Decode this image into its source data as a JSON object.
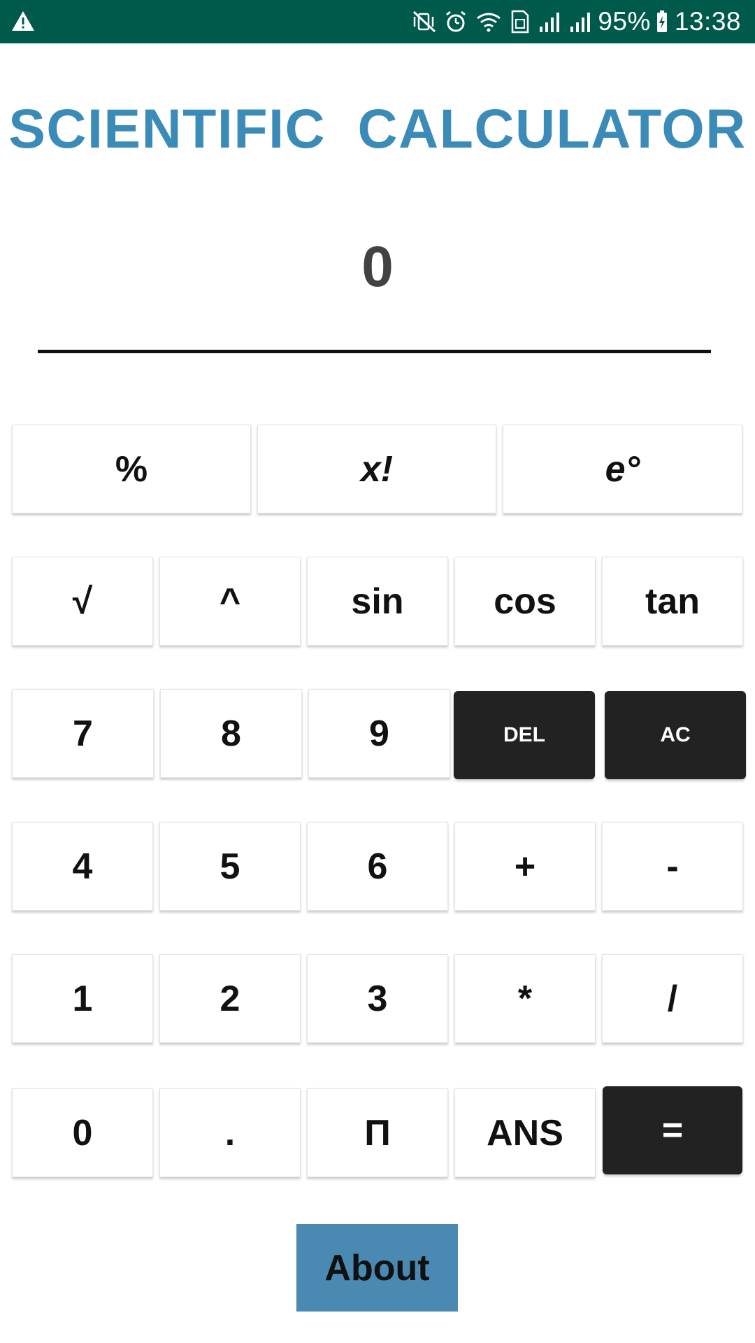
{
  "status_bar": {
    "warning_icon": "warning-triangle-icon",
    "icons": [
      "mute-vibrate-icon",
      "alarm-clock-icon",
      "wifi-icon",
      "sim-card-icon",
      "signal-icon",
      "signal-icon"
    ],
    "battery_percent": "95%",
    "time": "13:38"
  },
  "app": {
    "title": "SCIENTIFIC CALCULATOR",
    "display_value": "0",
    "title_color": "#3b8bb8",
    "accent_dark": "#222222"
  },
  "keys": {
    "row1": [
      "%",
      "x!",
      "e°"
    ],
    "row2": [
      "√",
      "^",
      "sin",
      "cos",
      "tan"
    ],
    "row3": [
      "7",
      "8",
      "9",
      "DEL",
      "AC"
    ],
    "row4": [
      "4",
      "5",
      "6",
      "+",
      "-"
    ],
    "row5": [
      "1",
      "2",
      "3",
      "*",
      "/"
    ],
    "row6": [
      "0",
      ".",
      "Π",
      "ANS",
      "="
    ]
  },
  "about_label": "About",
  "about_color": "#4a8ab2"
}
